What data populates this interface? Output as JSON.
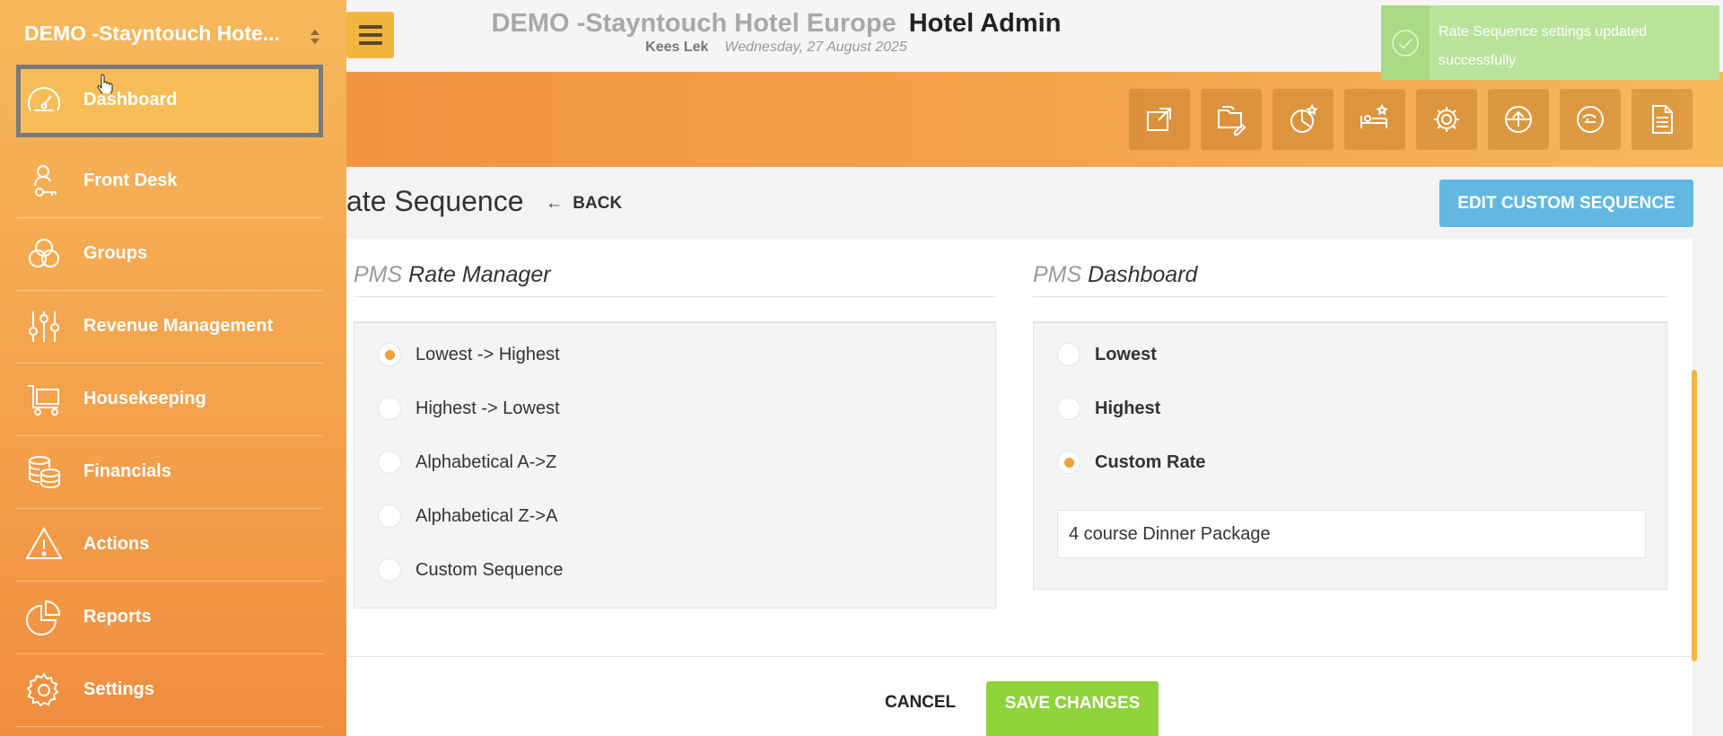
{
  "header": {
    "hotel_name": "DEMO -Stayntouch Hotel Europe",
    "app_title": "Hotel Admin",
    "user": "Kees Lek",
    "date": "Wednesday, 27 August 2025"
  },
  "toast": {
    "message": "Rate Sequence settings updated successfully",
    "icon": "check-circle-icon"
  },
  "toolbar": {
    "icons": [
      "external-link-icon",
      "folder-edit-icon",
      "chart-star-icon",
      "bed-star-icon",
      "gear-icon",
      "upload-icon",
      "cleaning-icon",
      "document-icon"
    ]
  },
  "sidebar": {
    "hotel_selector": "DEMO -Stayntouch Hote...",
    "items": [
      {
        "label": "Dashboard",
        "icon": "gauge-icon"
      },
      {
        "label": "Front Desk",
        "icon": "key-person-icon"
      },
      {
        "label": "Groups",
        "icon": "groups-icon"
      },
      {
        "label": "Revenue Management",
        "icon": "sliders-icon"
      },
      {
        "label": "Housekeeping",
        "icon": "cart-icon"
      },
      {
        "label": "Financials",
        "icon": "coins-icon"
      },
      {
        "label": "Actions",
        "icon": "warning-icon"
      },
      {
        "label": "Reports",
        "icon": "pie-chart-icon"
      },
      {
        "label": "Settings",
        "icon": "gear-icon"
      }
    ]
  },
  "page": {
    "title": "ate Sequence",
    "back_label": "BACK",
    "edit_button": "EDIT CUSTOM SEQUENCE",
    "cancel_label": "CANCEL",
    "save_label": "SAVE CHANGES"
  },
  "rate_manager": {
    "prefix": "PMS",
    "title": "Rate Manager",
    "options": [
      {
        "label": "Lowest -> Highest",
        "selected": true
      },
      {
        "label": "Highest -> Lowest",
        "selected": false
      },
      {
        "label": "Alphabetical A->Z",
        "selected": false
      },
      {
        "label": "Alphabetical Z->A",
        "selected": false
      },
      {
        "label": "Custom Sequence",
        "selected": false
      }
    ]
  },
  "dashboard": {
    "prefix": "PMS",
    "title": "Dashboard",
    "options": [
      {
        "label": "Lowest",
        "selected": false
      },
      {
        "label": "Highest",
        "selected": false
      },
      {
        "label": "Custom Rate",
        "selected": true
      }
    ],
    "custom_rate_value": "4 course Dinner Package"
  },
  "colors": {
    "accent": "#f3a24a",
    "edit_button": "#62b8e0",
    "save_button": "#8fd33a",
    "toast": "#b9e39a"
  }
}
